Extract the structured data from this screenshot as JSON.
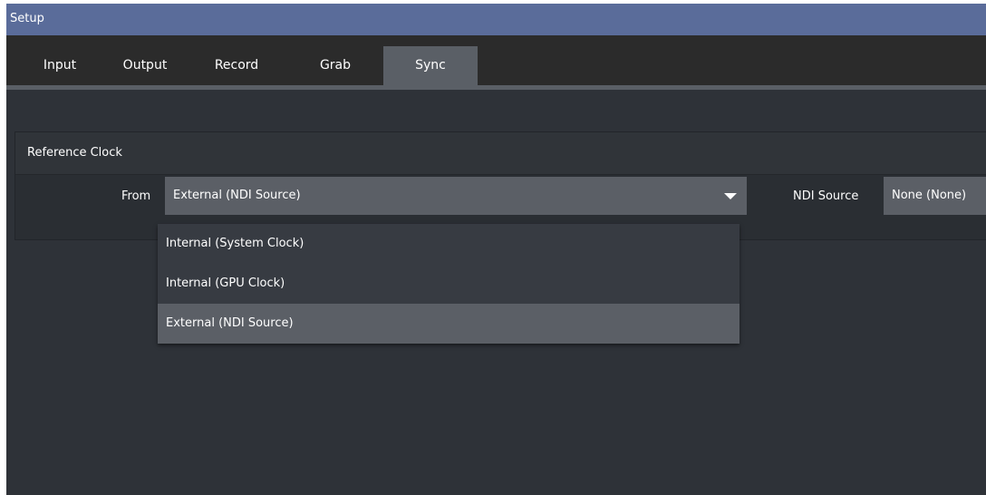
{
  "window": {
    "title": "Setup"
  },
  "tabs": [
    {
      "label": "Input",
      "active": false
    },
    {
      "label": "Output",
      "active": false
    },
    {
      "label": "Record",
      "active": false
    },
    {
      "label": "Grab",
      "active": false
    },
    {
      "label": "Sync",
      "active": true
    }
  ],
  "reference_clock": {
    "title": "Reference Clock",
    "from_label": "From",
    "from_value": "External (NDI Source)",
    "ndi_source_label": "NDI Source",
    "ndi_source_value": "None (None)"
  },
  "dropdown": {
    "options": [
      "Internal (System Clock)",
      "Internal (GPU Clock)",
      "External (NDI Source)"
    ],
    "selected_index": 2
  },
  "icons": {
    "dropdown_arrow": "chevron-down-icon"
  }
}
